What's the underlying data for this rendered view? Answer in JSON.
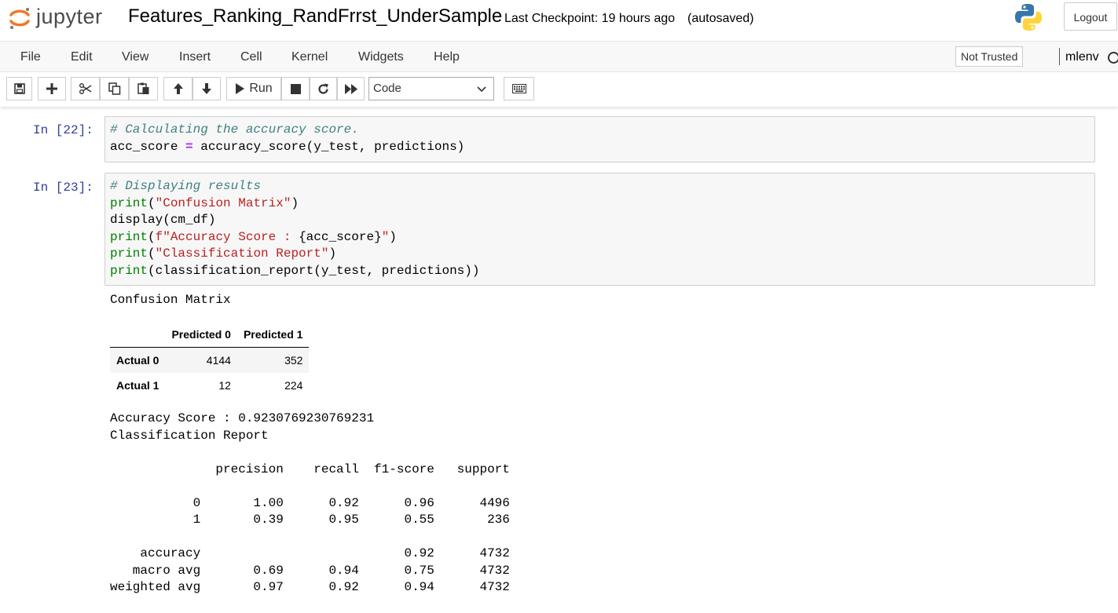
{
  "header": {
    "logo_text": "jupyter",
    "notebook_title": "Features_Ranking_RandFrrst_UnderSample",
    "checkpoint": "Last Checkpoint: 19 hours ago",
    "autosave": "(autosaved)",
    "logout_label": "Logout"
  },
  "menu": {
    "items": [
      "File",
      "Edit",
      "View",
      "Insert",
      "Cell",
      "Kernel",
      "Widgets",
      "Help"
    ],
    "trust_label": "Not Trusted",
    "kernel_name": "mlenv"
  },
  "toolbar": {
    "run_label": "Run",
    "cell_type": "Code",
    "icons": [
      "save-icon",
      "plus-icon",
      "cut-icon",
      "copy-icon",
      "paste-icon",
      "arrow-up-icon",
      "arrow-down-icon",
      "play-icon",
      "stop-icon",
      "restart-icon",
      "fast-forward-icon",
      "keyboard-icon"
    ]
  },
  "cells": [
    {
      "prompt": "In [22]:",
      "code": [
        "# Calculating the accuracy score.",
        "acc_score = accuracy_score(y_test, predictions)"
      ]
    },
    {
      "prompt": "In [23]:",
      "code": [
        "# Displaying results",
        "print(\"Confusion Matrix\")",
        "display(cm_df)",
        "print(f\"Accuracy Score : {acc_score}\")",
        "print(\"Classification Report\")",
        "print(classification_report(y_test, predictions))"
      ],
      "output_title": "Confusion Matrix",
      "dataframe": {
        "columns": [
          "Predicted 0",
          "Predicted 1"
        ],
        "rows": [
          {
            "label": "Actual 0",
            "values": [
              "4144",
              "352"
            ]
          },
          {
            "label": "Actual 1",
            "values": [
              "12",
              "224"
            ]
          }
        ]
      },
      "accuracy_line": "Accuracy Score : 0.9230769230769231",
      "report_title": "Classification Report",
      "report_lines": [
        "              precision    recall  f1-score   support",
        "",
        "           0       1.00      0.92      0.96      4496",
        "           1       0.39      0.95      0.55       236",
        "",
        "    accuracy                           0.92      4732",
        "   macro avg       0.69      0.94      0.75      4732",
        "weighted avg       0.97      0.92      0.94      4732"
      ]
    }
  ]
}
